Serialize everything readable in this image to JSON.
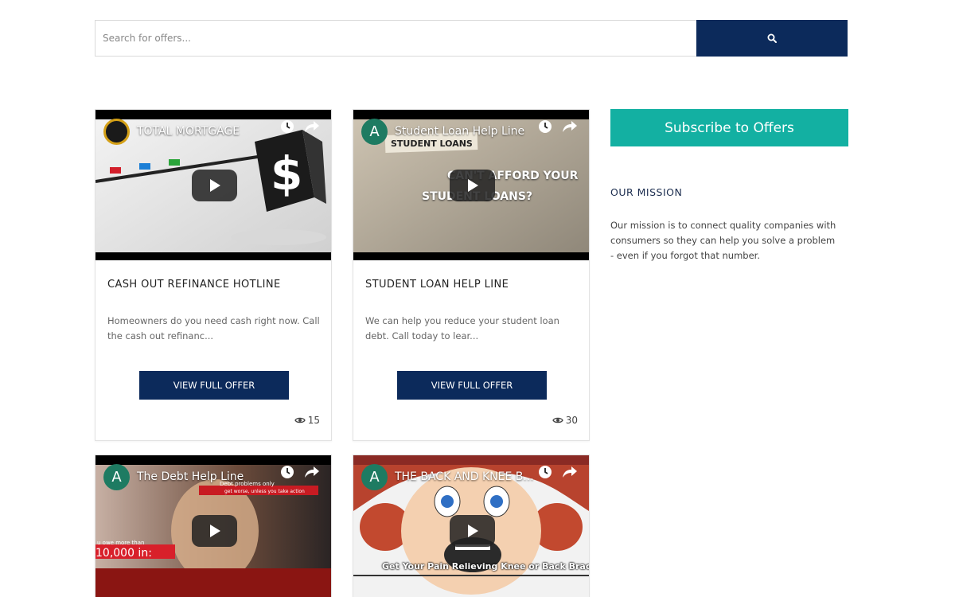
{
  "search": {
    "placeholder": "Search for offers..."
  },
  "offers": [
    {
      "video": {
        "channel_initial": "",
        "title": "TOTAL MORTGAGE"
      },
      "title": "CASH OUT REFINANCE HOTLINE",
      "description": "Homeowners do you need cash right now. Call the cash out refinanc...",
      "button_label": "VIEW FULL OFFER",
      "views": "15"
    },
    {
      "video": {
        "channel_initial": "A",
        "title": "Student Loan Help Line",
        "art_line1": "STUDENT LOANS",
        "art_line2": "CAN'T AFFORD YOUR",
        "art_line3": "STUDENT LOANS?"
      },
      "title": "STUDENT LOAN HELP LINE",
      "description": "We can help you reduce your student loan debt. Call today to lear...",
      "button_label": "VIEW FULL OFFER",
      "views": "30"
    },
    {
      "video": {
        "channel_initial": "A",
        "title": "The Debt Help Line",
        "art_line1": "Debt problems only",
        "art_line2": "get worse, unless you take action",
        "art_line3": "u owe more than",
        "art_line4": "10,000 in:"
      }
    },
    {
      "video": {
        "channel_initial": "A",
        "title": "THE BACK AND KNEE B...",
        "art_line1": "Get Your Pain Relieving Knee or Back Brace"
      }
    }
  ],
  "sidebar": {
    "subscribe_label": "Subscribe to Offers",
    "mission_title": "OUR MISSION",
    "mission_text": "Our mission is to connect quality companies with consumers so they can help you solve a problem - even if you forgot that number."
  },
  "colors": {
    "navy": "#0c2a5b",
    "teal": "#13b0a2",
    "avatar_green": "#1e7b62"
  }
}
